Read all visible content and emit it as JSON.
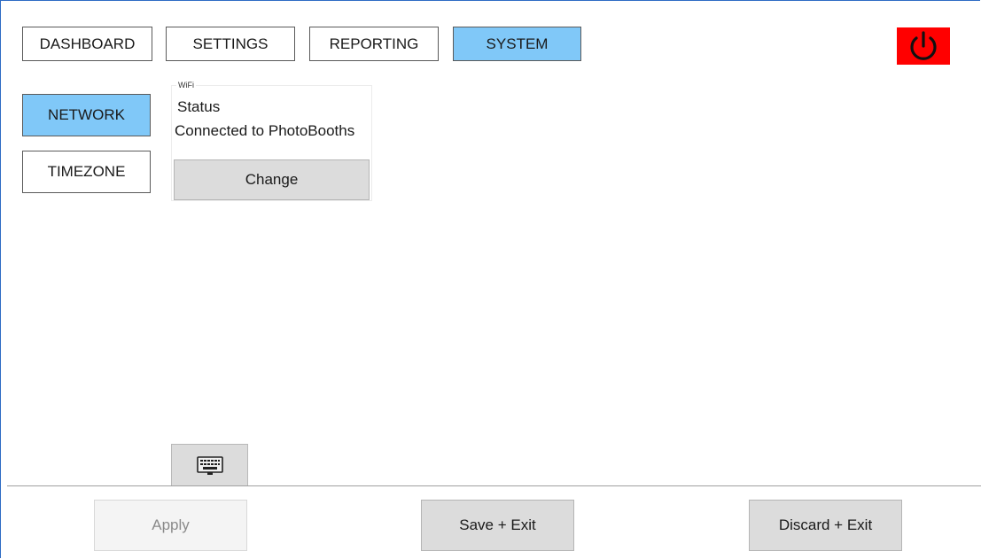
{
  "top_tabs": [
    {
      "label": "DASHBOARD",
      "active": false
    },
    {
      "label": "SETTINGS",
      "active": false
    },
    {
      "label": "REPORTING",
      "active": false
    },
    {
      "label": "SYSTEM",
      "active": true
    }
  ],
  "power_button": {
    "icon": "power-icon",
    "color": "#ff0000"
  },
  "side_nav": [
    {
      "label": "NETWORK",
      "active": true
    },
    {
      "label": "TIMEZONE",
      "active": false
    }
  ],
  "wifi": {
    "legend": "WiFi",
    "status_label": "Status",
    "status_value": "Connected to PhotoBooths",
    "change_label": "Change"
  },
  "keyboard_button": {
    "icon": "keyboard-icon"
  },
  "footer": {
    "apply_label": "Apply",
    "apply_disabled": true,
    "save_label": "Save + Exit",
    "discard_label": "Discard + Exit"
  },
  "colors": {
    "accent": "#80c8f8",
    "power": "#ff0000",
    "frame": "#2e6bc4"
  }
}
